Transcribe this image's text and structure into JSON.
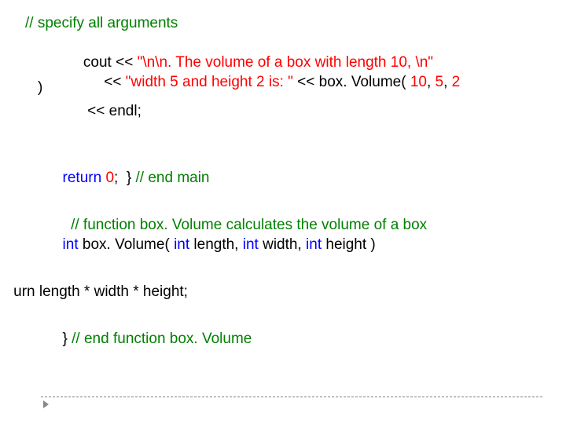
{
  "lines": {
    "l1a": "   ",
    "l1b": "// specify all arguments",
    "l2a": "          cout << ",
    "l2b": "\"\\n\\n. The volume of a box with length 10, \\n\"",
    "l3a": "               << ",
    "l3b": "\"width 5 and height 2 is: \"",
    "l3c": " << box. Volume( ",
    "l3d": "10",
    "l3e": ", ",
    "l3f": "5",
    "l3g": ", ",
    "l3h": "2",
    "l3i": " )",
    "l5": "               << endl;",
    "l7a": "     ",
    "l7b": "return",
    "l7c": " ",
    "l7d": "0",
    "l7e": ";  } ",
    "l7f": "// end main",
    "l9a": "       ",
    "l9b": "// function box. Volume calculates the volume of a box",
    "l10a": "     ",
    "l10b": "int",
    "l10c": " box. Volume( ",
    "l10d": "int",
    "l10e": " length, ",
    "l10f": "int",
    "l10g": " width, ",
    "l10h": "int",
    "l10i": " height )",
    "l12cut": "urn",
    "l12rest": " length * width * height;",
    "l14a": "     } ",
    "l14b": "// end function box. Volume"
  }
}
